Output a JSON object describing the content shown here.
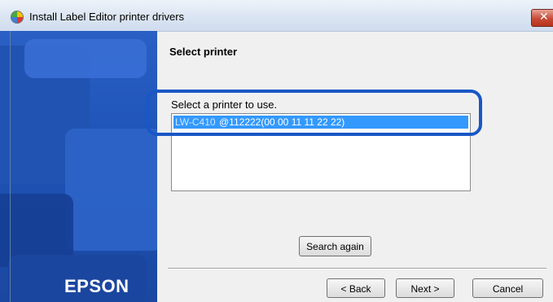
{
  "window": {
    "title": "Install Label Editor printer drivers",
    "close_glyph": "✕"
  },
  "sidebar": {
    "brand": "EPSON"
  },
  "content": {
    "heading": "Select printer",
    "prompt": "Select a printer to use.",
    "printers": [
      {
        "name": "LW-C410",
        "address": "@112222(00 00 11 11 22 22)",
        "selected": true
      }
    ],
    "search_button": "Search again"
  },
  "footer": {
    "back": "< Back",
    "next": "Next >",
    "cancel": "Cancel"
  },
  "colors": {
    "highlight": "#1957c6",
    "selection": "#3399ff",
    "sidebar": "#1f54b8"
  }
}
